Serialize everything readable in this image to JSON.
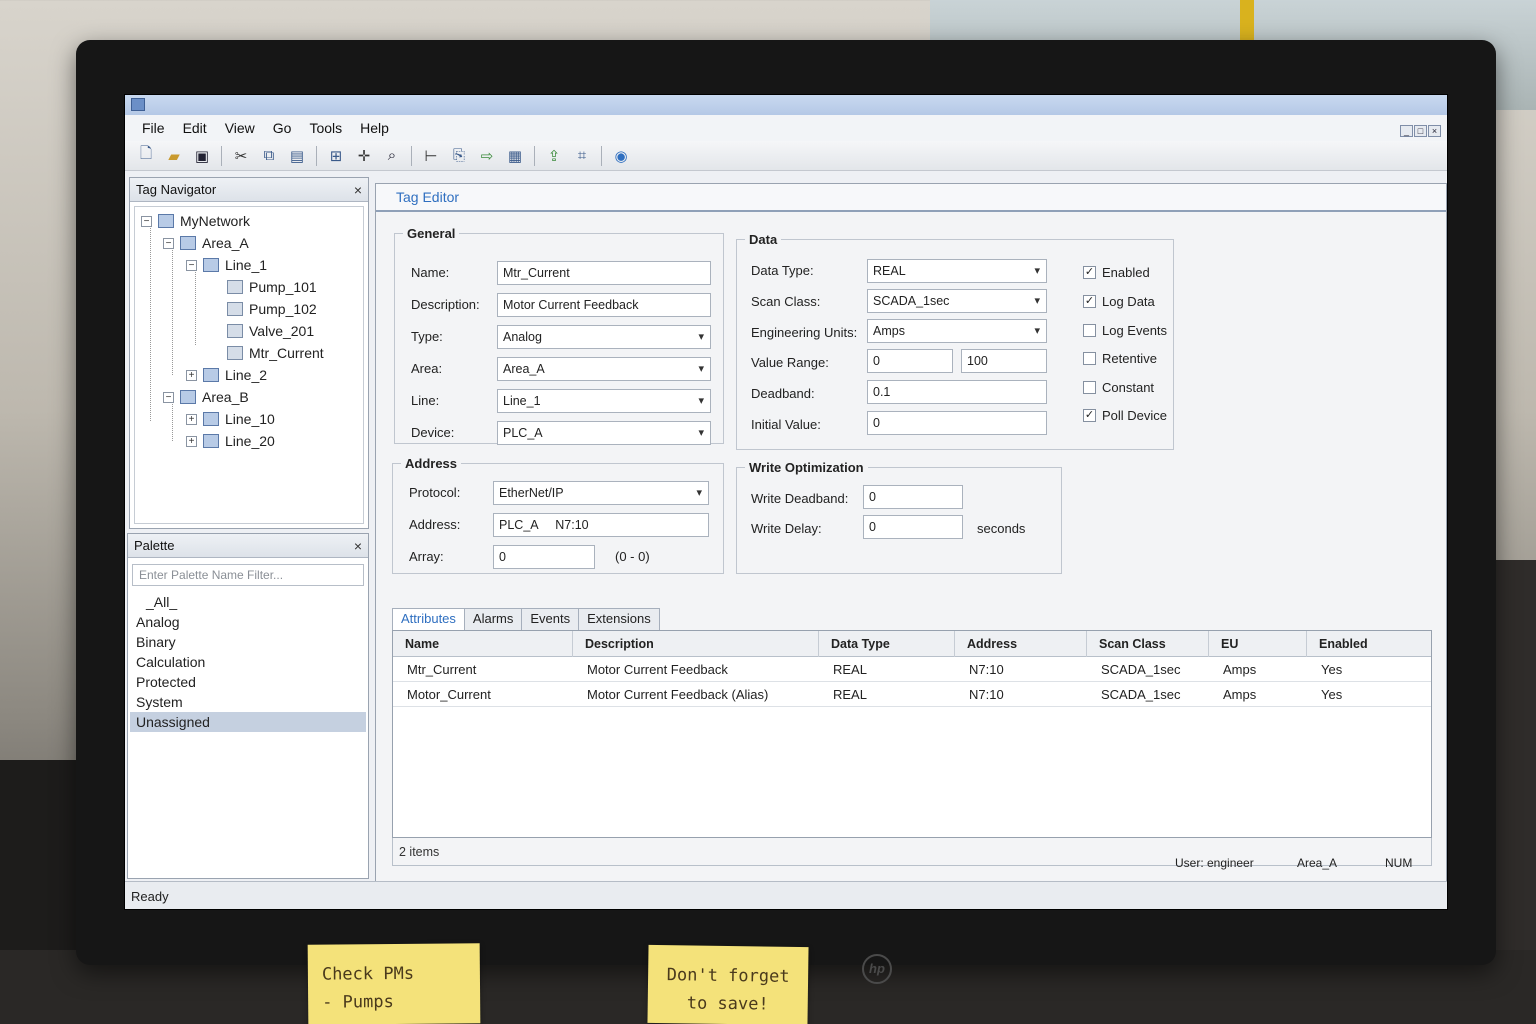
{
  "app": {
    "menu": [
      "File",
      "Edit",
      "View",
      "Go",
      "Tools",
      "Help"
    ],
    "window_buttons": [
      "_",
      "□",
      "×"
    ]
  },
  "toolbar_icons": [
    "new-file-icon",
    "open-folder-icon",
    "save-icon",
    "cut-icon",
    "copy-icon",
    "paste-icon",
    "add-tag-icon",
    "move-icon",
    "find-icon",
    "insert-icon",
    "import-icon",
    "export-icon",
    "report-icon",
    "deploy-icon",
    "browse-icon",
    "help-icon"
  ],
  "tag_navigator": {
    "title": "Tag Navigator",
    "close": "×",
    "tree": [
      {
        "label": "MyNetwork",
        "level": 0,
        "expanded": true
      },
      {
        "label": "Area_A",
        "level": 1,
        "expanded": true
      },
      {
        "label": "Line_1",
        "level": 2,
        "expanded": true
      },
      {
        "label": "Pump_101",
        "level": 3
      },
      {
        "label": "Pump_102",
        "level": 3
      },
      {
        "label": "Valve_201",
        "level": 3
      },
      {
        "label": "Mtr_Current",
        "level": 3
      },
      {
        "label": "Line_2",
        "level": 2,
        "expanded": false
      },
      {
        "label": "Area_B",
        "level": 1,
        "expanded": true
      },
      {
        "label": "Line_10",
        "level": 2,
        "expanded": false
      },
      {
        "label": "Line_20",
        "level": 2,
        "expanded": false
      }
    ]
  },
  "palette": {
    "title": "Palette",
    "close": "×",
    "filter_placeholder": "Enter Palette Name Filter...",
    "items": [
      "_All_",
      "Analog",
      "Binary",
      "Calculation",
      "Protected",
      "System",
      "Unassigned"
    ],
    "selected": "Unassigned"
  },
  "editor": {
    "title": "Tag Editor",
    "general": {
      "legend": "General",
      "name_label": "Name:",
      "name": "Mtr_Current",
      "description_label": "Description:",
      "description": "Motor Current Feedback",
      "type_label": "Type:",
      "type": "Analog",
      "area_label": "Area:",
      "area": "Area_A",
      "line_label": "Line:",
      "line": "Line_1",
      "device_label": "Device:",
      "device": "PLC_A"
    },
    "data": {
      "legend": "Data",
      "data_type_label": "Data Type:",
      "data_type": "REAL",
      "scan_class_label": "Scan Class:",
      "scan_class": "SCADA_1sec",
      "eu_label": "Engineering Units:",
      "eu": "Amps",
      "value_range_label": "Value Range:",
      "range_min": "0",
      "range_max": "100",
      "deadband_label": "Deadband:",
      "deadband": "0.1",
      "initial_label": "Initial Value:",
      "initial": "0",
      "checks": [
        {
          "label": "Enabled",
          "checked": true
        },
        {
          "label": "Log Data",
          "checked": true
        },
        {
          "label": "Log Events",
          "checked": false
        },
        {
          "label": "Retentive",
          "checked": false
        },
        {
          "label": "Constant",
          "checked": false
        },
        {
          "label": "Poll Device",
          "checked": true
        }
      ]
    },
    "address": {
      "legend": "Address",
      "protocol_label": "Protocol:",
      "protocol": "EtherNet/IP",
      "address_label": "Address:",
      "address": "PLC_A     N7:10",
      "array_label": "Array:",
      "array": "0",
      "array_range": "(0 - 0)"
    },
    "write_opt": {
      "legend": "Write Optimization",
      "deadband_label": "Write Deadband:",
      "deadband": "0",
      "delay_label": "Write Delay:",
      "delay": "0",
      "delay_unit": "seconds"
    },
    "tabs": [
      "Attributes",
      "Alarms",
      "Events",
      "Extensions"
    ],
    "active_tab": "Attributes",
    "grid": {
      "columns": [
        "Name",
        "Description",
        "Data Type",
        "Address",
        "Scan Class",
        "EU",
        "Enabled"
      ],
      "rows": [
        [
          "Mtr_Current",
          "Motor Current Feedback",
          "REAL",
          "N7:10",
          "SCADA_1sec",
          "Amps",
          "Yes"
        ],
        [
          "Motor_Current",
          "Motor Current Feedback (Alias)",
          "REAL",
          "N7:10",
          "SCADA_1sec",
          "Amps",
          "Yes"
        ]
      ],
      "footer": "2 items"
    }
  },
  "status": {
    "ready": "Ready",
    "user": "User: engineer",
    "area": "Area_A",
    "num": "NUM"
  },
  "sticky_notes": {
    "left": [
      "Check PMs",
      "- Pumps"
    ],
    "right": [
      "Don't forget",
      "to save!"
    ]
  },
  "colors": {
    "accent": "#2f6fc0",
    "selection": "#c5d0e0",
    "sticky": "#f4e27a"
  }
}
